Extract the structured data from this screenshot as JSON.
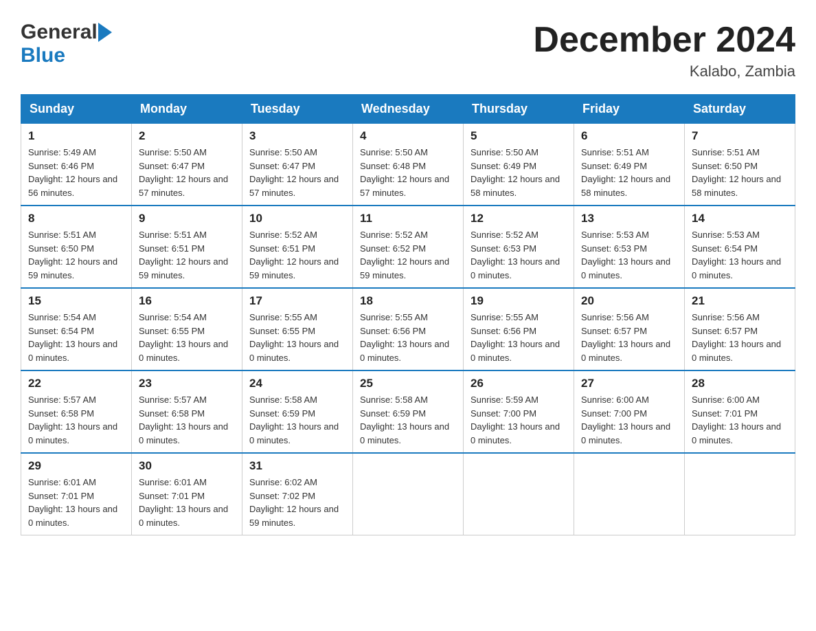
{
  "header": {
    "logo_general": "General",
    "logo_blue": "Blue",
    "title": "December 2024",
    "subtitle": "Kalabo, Zambia"
  },
  "days_of_week": [
    "Sunday",
    "Monday",
    "Tuesday",
    "Wednesday",
    "Thursday",
    "Friday",
    "Saturday"
  ],
  "weeks": [
    [
      {
        "day": "1",
        "sunrise": "5:49 AM",
        "sunset": "6:46 PM",
        "daylight": "12 hours and 56 minutes."
      },
      {
        "day": "2",
        "sunrise": "5:50 AM",
        "sunset": "6:47 PM",
        "daylight": "12 hours and 57 minutes."
      },
      {
        "day": "3",
        "sunrise": "5:50 AM",
        "sunset": "6:47 PM",
        "daylight": "12 hours and 57 minutes."
      },
      {
        "day": "4",
        "sunrise": "5:50 AM",
        "sunset": "6:48 PM",
        "daylight": "12 hours and 57 minutes."
      },
      {
        "day": "5",
        "sunrise": "5:50 AM",
        "sunset": "6:49 PM",
        "daylight": "12 hours and 58 minutes."
      },
      {
        "day": "6",
        "sunrise": "5:51 AM",
        "sunset": "6:49 PM",
        "daylight": "12 hours and 58 minutes."
      },
      {
        "day": "7",
        "sunrise": "5:51 AM",
        "sunset": "6:50 PM",
        "daylight": "12 hours and 58 minutes."
      }
    ],
    [
      {
        "day": "8",
        "sunrise": "5:51 AM",
        "sunset": "6:50 PM",
        "daylight": "12 hours and 59 minutes."
      },
      {
        "day": "9",
        "sunrise": "5:51 AM",
        "sunset": "6:51 PM",
        "daylight": "12 hours and 59 minutes."
      },
      {
        "day": "10",
        "sunrise": "5:52 AM",
        "sunset": "6:51 PM",
        "daylight": "12 hours and 59 minutes."
      },
      {
        "day": "11",
        "sunrise": "5:52 AM",
        "sunset": "6:52 PM",
        "daylight": "12 hours and 59 minutes."
      },
      {
        "day": "12",
        "sunrise": "5:52 AM",
        "sunset": "6:53 PM",
        "daylight": "13 hours and 0 minutes."
      },
      {
        "day": "13",
        "sunrise": "5:53 AM",
        "sunset": "6:53 PM",
        "daylight": "13 hours and 0 minutes."
      },
      {
        "day": "14",
        "sunrise": "5:53 AM",
        "sunset": "6:54 PM",
        "daylight": "13 hours and 0 minutes."
      }
    ],
    [
      {
        "day": "15",
        "sunrise": "5:54 AM",
        "sunset": "6:54 PM",
        "daylight": "13 hours and 0 minutes."
      },
      {
        "day": "16",
        "sunrise": "5:54 AM",
        "sunset": "6:55 PM",
        "daylight": "13 hours and 0 minutes."
      },
      {
        "day": "17",
        "sunrise": "5:55 AM",
        "sunset": "6:55 PM",
        "daylight": "13 hours and 0 minutes."
      },
      {
        "day": "18",
        "sunrise": "5:55 AM",
        "sunset": "6:56 PM",
        "daylight": "13 hours and 0 minutes."
      },
      {
        "day": "19",
        "sunrise": "5:55 AM",
        "sunset": "6:56 PM",
        "daylight": "13 hours and 0 minutes."
      },
      {
        "day": "20",
        "sunrise": "5:56 AM",
        "sunset": "6:57 PM",
        "daylight": "13 hours and 0 minutes."
      },
      {
        "day": "21",
        "sunrise": "5:56 AM",
        "sunset": "6:57 PM",
        "daylight": "13 hours and 0 minutes."
      }
    ],
    [
      {
        "day": "22",
        "sunrise": "5:57 AM",
        "sunset": "6:58 PM",
        "daylight": "13 hours and 0 minutes."
      },
      {
        "day": "23",
        "sunrise": "5:57 AM",
        "sunset": "6:58 PM",
        "daylight": "13 hours and 0 minutes."
      },
      {
        "day": "24",
        "sunrise": "5:58 AM",
        "sunset": "6:59 PM",
        "daylight": "13 hours and 0 minutes."
      },
      {
        "day": "25",
        "sunrise": "5:58 AM",
        "sunset": "6:59 PM",
        "daylight": "13 hours and 0 minutes."
      },
      {
        "day": "26",
        "sunrise": "5:59 AM",
        "sunset": "7:00 PM",
        "daylight": "13 hours and 0 minutes."
      },
      {
        "day": "27",
        "sunrise": "6:00 AM",
        "sunset": "7:00 PM",
        "daylight": "13 hours and 0 minutes."
      },
      {
        "day": "28",
        "sunrise": "6:00 AM",
        "sunset": "7:01 PM",
        "daylight": "13 hours and 0 minutes."
      }
    ],
    [
      {
        "day": "29",
        "sunrise": "6:01 AM",
        "sunset": "7:01 PM",
        "daylight": "13 hours and 0 minutes."
      },
      {
        "day": "30",
        "sunrise": "6:01 AM",
        "sunset": "7:01 PM",
        "daylight": "13 hours and 0 minutes."
      },
      {
        "day": "31",
        "sunrise": "6:02 AM",
        "sunset": "7:02 PM",
        "daylight": "12 hours and 59 minutes."
      },
      null,
      null,
      null,
      null
    ]
  ]
}
